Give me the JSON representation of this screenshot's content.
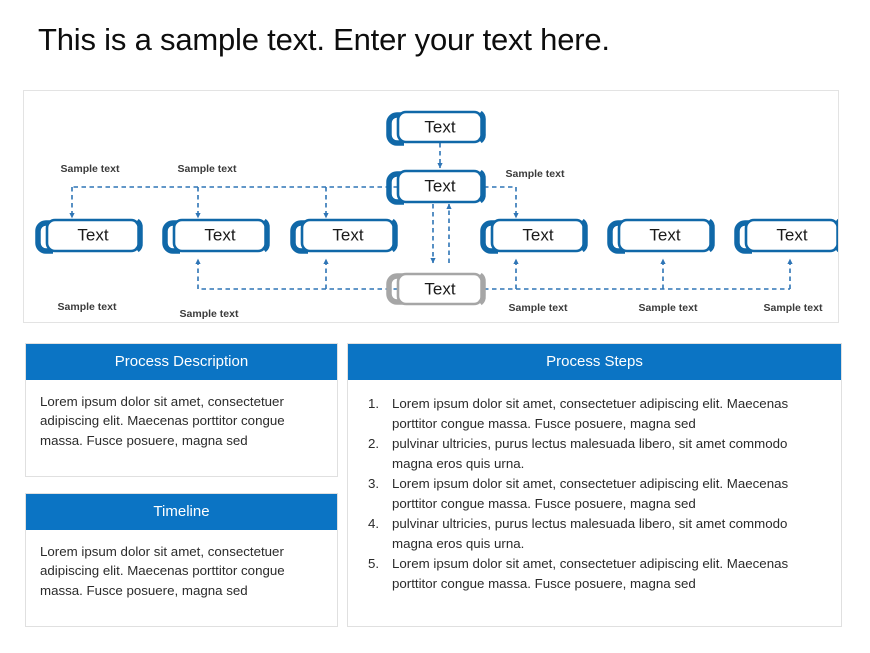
{
  "title": "This is a sample text. Enter your text here.",
  "colors": {
    "accent_blue": "#0b74c4",
    "node_border_blue": "#1068a8",
    "node_border_gray": "#a6a6a6",
    "connector_blue": "#2e75b6",
    "panel_border": "#e3e3e3"
  },
  "diagram": {
    "nodes": {
      "top": {
        "label": "Text",
        "style": "blue"
      },
      "second": {
        "label": "Text",
        "style": "blue"
      },
      "center_gray": {
        "label": "Text",
        "style": "gray"
      },
      "row": [
        {
          "label": "Text",
          "style": "blue"
        },
        {
          "label": "Text",
          "style": "blue"
        },
        {
          "label": "Text",
          "style": "blue"
        },
        {
          "label": "Text",
          "style": "blue"
        },
        {
          "label": "Text",
          "style": "blue"
        },
        {
          "label": "Text",
          "style": "blue"
        }
      ]
    },
    "labels_top": [
      {
        "text": "Sample text"
      },
      {
        "text": "Sample text"
      },
      {
        "text": "Sample text"
      }
    ],
    "labels_bottom": [
      {
        "text": "Sample text"
      },
      {
        "text": "Sample text"
      },
      {
        "text": "Sample text"
      },
      {
        "text": "Sample text"
      },
      {
        "text": "Sample text"
      }
    ]
  },
  "cards": {
    "process_description": {
      "header": "Process Description",
      "body": "Lorem ipsum dolor sit amet, consectetuer adipiscing elit. Maecenas porttitor congue massa. Fusce posuere, magna sed"
    },
    "timeline": {
      "header": "Timeline",
      "body": "Lorem ipsum dolor sit amet, consectetuer adipiscing elit. Maecenas porttitor congue massa. Fusce posuere, magna sed"
    },
    "process_steps": {
      "header": "Process Steps",
      "steps": [
        {
          "number": "1.",
          "text": "Lorem ipsum dolor sit amet, consectetuer adipiscing elit. Maecenas porttitor congue massa. Fusce posuere, magna sed"
        },
        {
          "number": "2.",
          "text": "pulvinar ultricies, purus lectus malesuada libero, sit amet commodo magna eros quis urna."
        },
        {
          "number": "3.",
          "text": "Lorem ipsum dolor sit amet, consectetuer adipiscing elit. Maecenas porttitor congue massa. Fusce posuere, magna sed"
        },
        {
          "number": "4.",
          "text": "pulvinar ultricies, purus lectus malesuada libero, sit amet commodo magna eros quis urna."
        },
        {
          "number": "5.",
          "text": "Lorem ipsum dolor sit amet, consectetuer adipiscing elit. Maecenas porttitor congue massa. Fusce posuere, magna sed"
        }
      ]
    }
  }
}
